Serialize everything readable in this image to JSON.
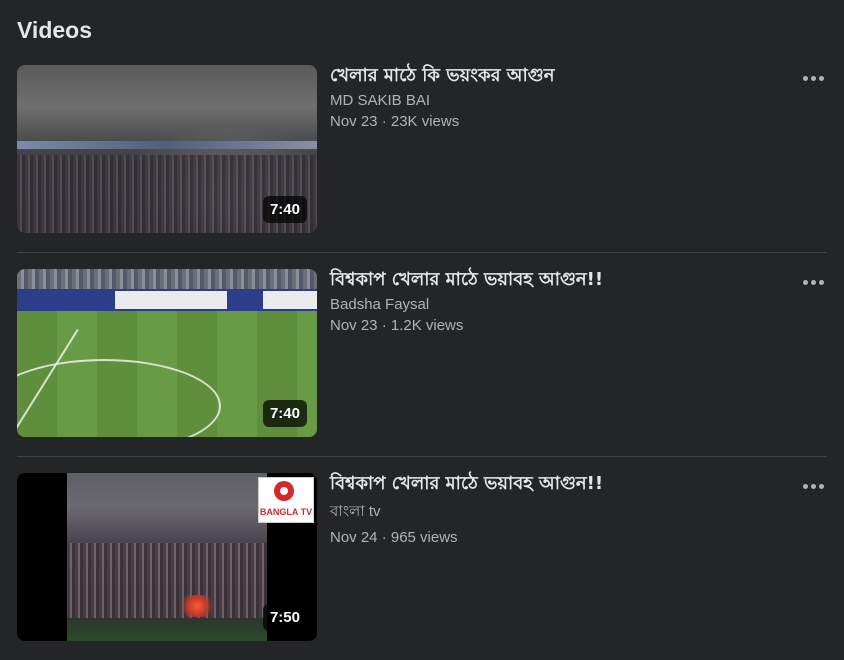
{
  "section": {
    "title": "Videos"
  },
  "videos": [
    {
      "title": "খেলার মাঠে কি ভয়ংকর আগুন",
      "channel": "MD SAKIB BAI",
      "meta": "Nov 23 · 23K views",
      "duration": "7:40"
    },
    {
      "title": "বিশ্বকাপ খেলার মাঠে ভয়াবহ আগুন!!",
      "channel": "Badsha Faysal",
      "meta": "Nov 23 · 1.2K views",
      "duration": "7:40"
    },
    {
      "title": "বিশ্বকাপ খেলার মাঠে ভয়াবহ আগুন!!",
      "channel": "বাংলা tv",
      "meta": "Nov 24 · 965 views",
      "duration": "7:50",
      "logo_text": "BANGLA TV"
    }
  ],
  "icons": {
    "more": "more-horizontal-icon"
  },
  "colors": {
    "background": "#242526",
    "text": "#e4e6eb",
    "secondary_text": "#b0b3b8"
  }
}
